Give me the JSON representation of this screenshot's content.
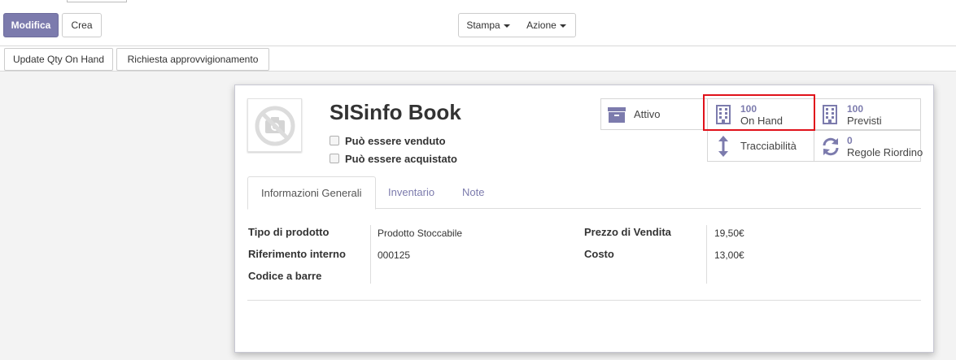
{
  "control_panel": {
    "edit_label": "Modifica",
    "create_label": "Crea",
    "print_label": "Stampa",
    "action_label": "Azione"
  },
  "statusbar": {
    "update_qty_label": "Update Qty On Hand",
    "procurement_label": "Richiesta approvvigionamento"
  },
  "product": {
    "name": "SISinfo Book",
    "can_be_sold_label": "Può essere venduto",
    "can_be_purchased_label": "Può essere acquistato",
    "can_be_sold": false,
    "can_be_purchased": false,
    "image_icon": "camera-off-icon"
  },
  "smart_buttons": {
    "active": {
      "label": "Attivo",
      "icon": "archive-icon"
    },
    "on_hand": {
      "value": "100",
      "label": "On Hand",
      "icon": "building-icon"
    },
    "forecast": {
      "value": "100",
      "label": "Previsti",
      "icon": "building-icon"
    },
    "traceability": {
      "label": "Tracciabilità",
      "icon": "arrows-vertical-icon"
    },
    "reorder_rules": {
      "value": "0",
      "label": "Regole Riordino",
      "icon": "refresh-icon"
    },
    "highlight_color": "#e0121b"
  },
  "tabs": [
    {
      "label": "Informazioni Generali",
      "active": true
    },
    {
      "label": "Inventario",
      "active": false
    },
    {
      "label": "Note",
      "active": false
    }
  ],
  "general_info": {
    "left": [
      {
        "label": "Tipo di prodotto",
        "value": "Prodotto Stoccabile"
      },
      {
        "label": "Riferimento interno",
        "value": "000125"
      },
      {
        "label": "Codice a barre",
        "value": ""
      }
    ],
    "right": [
      {
        "label": "Prezzo di Vendita",
        "value": "19,50€"
      },
      {
        "label": "Costo",
        "value": "13,00€"
      }
    ]
  },
  "colors": {
    "primary": "#7c7bad",
    "link": "#7c7bad"
  }
}
